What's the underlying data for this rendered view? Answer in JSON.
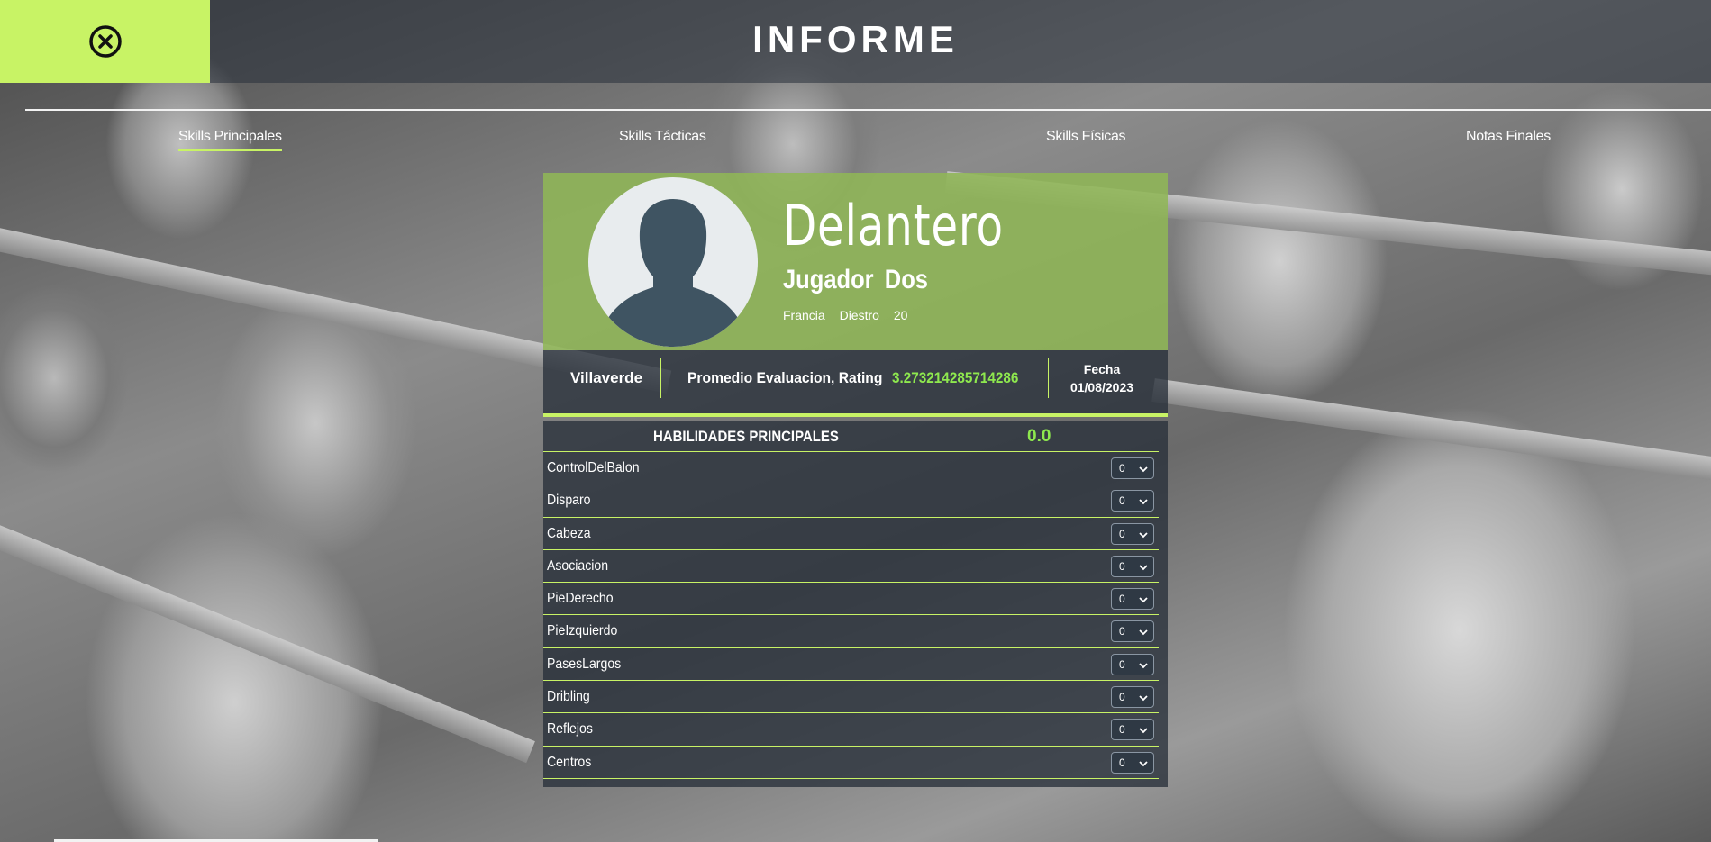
{
  "header": {
    "title": "INFORME",
    "close_icon": "close-circle-icon",
    "accent_color": "#c8f365"
  },
  "tabs": [
    {
      "label": "Skills Principales",
      "active": true
    },
    {
      "label": "Skills Tácticas",
      "active": false
    },
    {
      "label": "Skills Físicas",
      "active": false
    },
    {
      "label": "Notas Finales",
      "active": false
    }
  ],
  "player": {
    "position": "Delantero",
    "first_name": "Jugador",
    "last_name": "Dos",
    "country": "Francia",
    "foot": "Diestro",
    "age": "20",
    "avatar_icon": "user-silhouette-icon"
  },
  "info": {
    "club": "Villaverde",
    "rating_label": "Promedio Evaluacion, Rating",
    "rating_value": "3.273214285714286",
    "date_label": "Fecha",
    "date_value": "01/08/2023"
  },
  "skills": {
    "title": "HABILIDADES PRINCIPALES",
    "average": "0.0",
    "items": [
      {
        "name": "ControlDelBalon",
        "value": "0"
      },
      {
        "name": "Disparo",
        "value": "0"
      },
      {
        "name": "Cabeza",
        "value": "0"
      },
      {
        "name": "Asociacion",
        "value": "0"
      },
      {
        "name": "PieDerecho",
        "value": "0"
      },
      {
        "name": "PieIzquierdo",
        "value": "0"
      },
      {
        "name": "PasesLargos",
        "value": "0"
      },
      {
        "name": "Dribling",
        "value": "0"
      },
      {
        "name": "Reflejos",
        "value": "0"
      },
      {
        "name": "Centros",
        "value": "0"
      }
    ]
  }
}
